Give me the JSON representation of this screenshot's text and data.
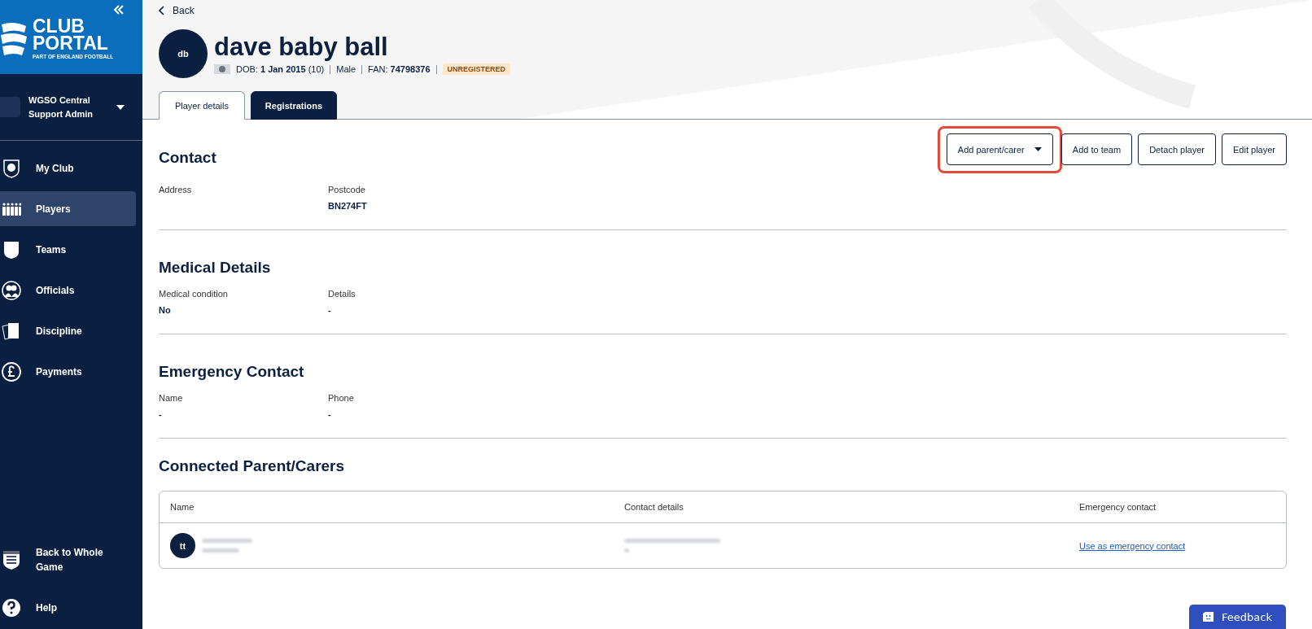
{
  "sidebar": {
    "logo": {
      "title_line_1": "CLUB",
      "title_line_2": "PORTAL",
      "tagline": "PART OF ENGLAND FOOTBALL"
    },
    "account": {
      "line_1": "WGSO Central",
      "line_2": "Support Admin"
    },
    "nav": [
      {
        "label": "My Club",
        "selected": false
      },
      {
        "label": "Players",
        "selected": true
      },
      {
        "label": "Teams",
        "selected": false
      },
      {
        "label": "Officials",
        "selected": false
      },
      {
        "label": "Discipline",
        "selected": false
      },
      {
        "label": "Payments",
        "selected": false
      }
    ],
    "footer": [
      {
        "label": "Back to Whole Game"
      },
      {
        "label": "Help"
      }
    ]
  },
  "header": {
    "back": "Back",
    "initials": "db",
    "name": "dave baby ball",
    "dob": "DOB: **1 Jan 2015** (10)",
    "gender": "Male",
    "fan": "FAN: **74798376**",
    "status": "UNREGISTERED"
  },
  "tabs": [
    {
      "label": "Player details",
      "selected": true
    },
    {
      "label": "Registrations",
      "selected": false
    }
  ],
  "actions": [
    {
      "label": "Add parent/carer",
      "dropdown": true,
      "highlighted": true
    },
    {
      "label": "Add to team",
      "dropdown": false,
      "highlighted": false
    },
    {
      "label": "Detach player",
      "dropdown": false,
      "highlighted": false
    },
    {
      "label": "Edit player",
      "dropdown": false,
      "highlighted": false
    }
  ],
  "sections": [
    {
      "title": "Contact",
      "fields": [
        {
          "label": "Address"
        },
        {
          "label": "Postcode",
          "value": "BN274FT"
        }
      ]
    },
    {
      "title": "Medical Details",
      "fields": [
        {
          "label": "Medical condition",
          "value": "No"
        },
        {
          "label": "Details",
          "value": "-"
        }
      ]
    },
    {
      "title": "Emergency Contact",
      "fields": [
        {
          "label": "Name",
          "value": "-"
        },
        {
          "label": "Phone",
          "value": "-"
        }
      ]
    }
  ],
  "connected": {
    "title": "Connected Parent/Carers",
    "columns": [
      "Name",
      "Contact details",
      "Emergency contact"
    ],
    "rows": [
      {
        "initials": "tt",
        "redacted": true,
        "action": "Use as emergency contact"
      }
    ]
  },
  "feedback": "Feedback"
}
